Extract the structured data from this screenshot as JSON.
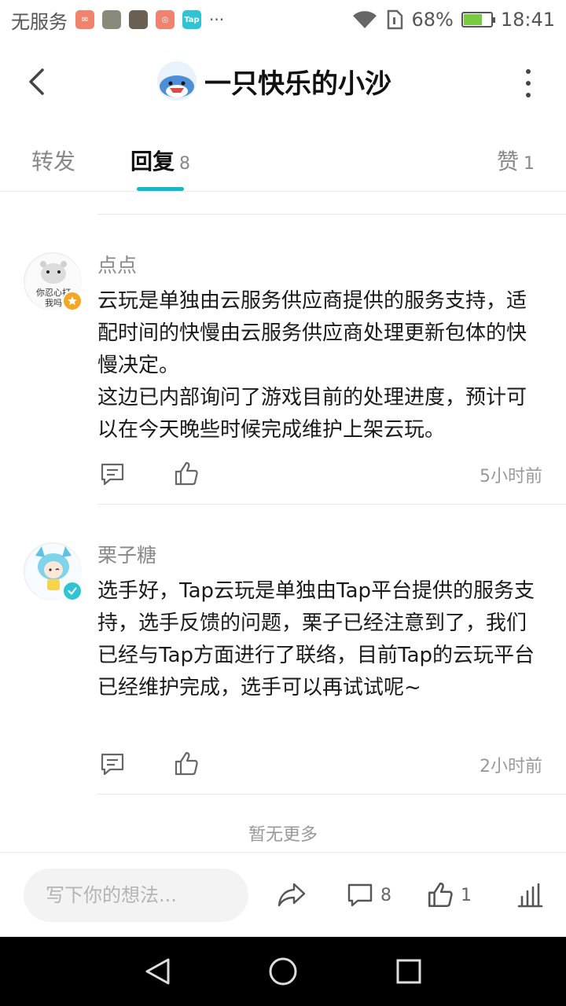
{
  "status_bar": {
    "carrier": "无服务",
    "battery": "68%",
    "battery_level": 0.68,
    "time": "18:41",
    "more_notifications": "···",
    "tap_icon_label": "Tap"
  },
  "header": {
    "title": "一只快乐的小沙"
  },
  "tabs": {
    "forward": "转发",
    "reply": "回复",
    "reply_count": "8",
    "like": "赞",
    "like_count": "1"
  },
  "comments": [
    {
      "author": "点点",
      "avatar_caption_1": "你忍心打",
      "avatar_caption_2": "我吗",
      "text": "云玩是单独由云服务供应商提供的服务支持，适配时间的快慢由云服务供应商处理更新包体的快慢决定。\n这边已内部询问了游戏目前的处理进度，预计可以在今天晚些时候完成维护上架云玩。",
      "time": "5小时前"
    },
    {
      "author": "栗子糖",
      "text": "选手好，Tap云玩是单独由Tap平台提供的服务支持，选手反馈的问题，栗子已经注意到了，我们已经与Tap方面进行了联络，目前Tap的云玩平台已经维护完成，选手可以再试试呢~",
      "time": "2小时前"
    }
  ],
  "no_more": "暂无更多",
  "bottom_bar": {
    "input_placeholder": "写下你的想法...",
    "comment_count": "8",
    "like_count": "1"
  },
  "colors": {
    "accent": "#14b9c8",
    "badge_orange": "#f5a623",
    "badge_teal": "#2ec4d6"
  }
}
